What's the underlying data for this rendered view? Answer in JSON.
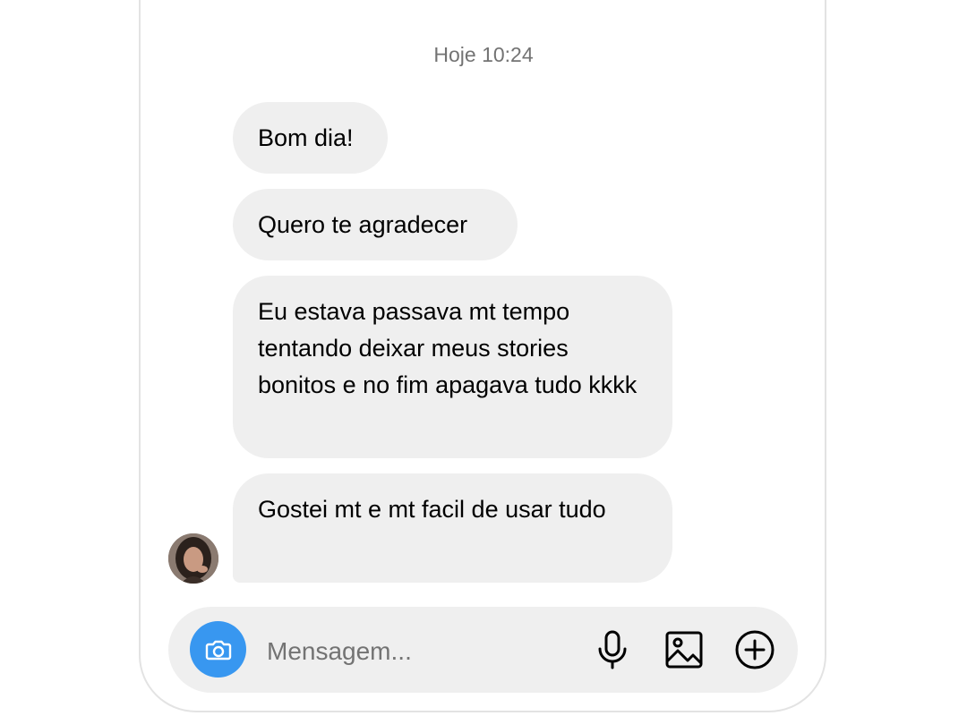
{
  "chat": {
    "timestamp": "Hoje 10:24",
    "messages": [
      {
        "text": "Bom dia!"
      },
      {
        "text": "Quero te agradecer"
      },
      {
        "text": "Eu estava passava mt tempo tentando deixar meus stories bonitos e no fim apagava tudo kkkk"
      },
      {
        "text": "Gostei mt e mt facil de usar tudo"
      }
    ]
  },
  "composer": {
    "placeholder": "Mensagem...",
    "icons": [
      "camera-icon",
      "microphone-icon",
      "image-icon",
      "plus-circle-icon"
    ]
  },
  "colors": {
    "bubble": "#efefef",
    "camera_button": "#3897f0",
    "timestamp_text": "#737373"
  }
}
